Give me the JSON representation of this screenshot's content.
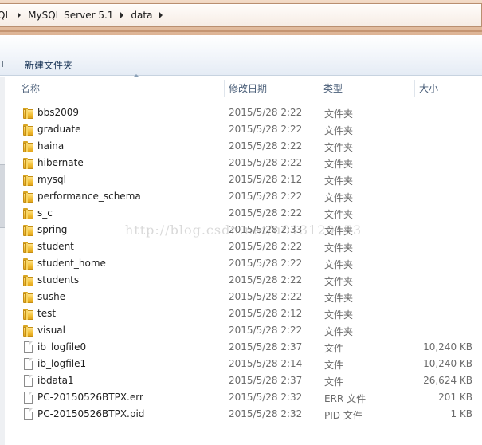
{
  "breadcrumb": {
    "items": [
      "QL",
      "MySQL Server 5.1",
      "data"
    ]
  },
  "toolbar": {
    "new_folder_label": "新建文件夹"
  },
  "columns": {
    "name": "名称",
    "date": "修改日期",
    "type": "类型",
    "size": "大小"
  },
  "rows": [
    {
      "name": "bbs2009",
      "date": "2015/5/28 2:22",
      "type": "文件夹",
      "size": "",
      "icon": "folder-icon"
    },
    {
      "name": "graduate",
      "date": "2015/5/28 2:22",
      "type": "文件夹",
      "size": "",
      "icon": "folder-icon"
    },
    {
      "name": "haina",
      "date": "2015/5/28 2:22",
      "type": "文件夹",
      "size": "",
      "icon": "folder-icon"
    },
    {
      "name": "hibernate",
      "date": "2015/5/28 2:22",
      "type": "文件夹",
      "size": "",
      "icon": "folder-icon"
    },
    {
      "name": "mysql",
      "date": "2015/5/28 2:12",
      "type": "文件夹",
      "size": "",
      "icon": "folder-icon"
    },
    {
      "name": "performance_schema",
      "date": "2015/5/28 2:22",
      "type": "文件夹",
      "size": "",
      "icon": "folder-icon"
    },
    {
      "name": "s_c",
      "date": "2015/5/28 2:22",
      "type": "文件夹",
      "size": "",
      "icon": "folder-icon"
    },
    {
      "name": "spring",
      "date": "2015/5/28 2:33",
      "type": "文件夹",
      "size": "",
      "icon": "folder-icon"
    },
    {
      "name": "student",
      "date": "2015/5/28 2:22",
      "type": "文件夹",
      "size": "",
      "icon": "folder-icon"
    },
    {
      "name": "student_home",
      "date": "2015/5/28 2:22",
      "type": "文件夹",
      "size": "",
      "icon": "folder-icon"
    },
    {
      "name": "students",
      "date": "2015/5/28 2:22",
      "type": "文件夹",
      "size": "",
      "icon": "folder-icon"
    },
    {
      "name": "sushe",
      "date": "2015/5/28 2:22",
      "type": "文件夹",
      "size": "",
      "icon": "folder-icon"
    },
    {
      "name": "test",
      "date": "2015/5/28 2:12",
      "type": "文件夹",
      "size": "",
      "icon": "folder-icon"
    },
    {
      "name": "visual",
      "date": "2015/5/28 2:22",
      "type": "文件夹",
      "size": "",
      "icon": "folder-icon"
    },
    {
      "name": "ib_logfile0",
      "date": "2015/5/28 2:37",
      "type": "文件",
      "size": "10,240 KB",
      "icon": "file-icon"
    },
    {
      "name": "ib_logfile1",
      "date": "2015/5/28 2:14",
      "type": "文件",
      "size": "10,240 KB",
      "icon": "file-icon"
    },
    {
      "name": "ibdata1",
      "date": "2015/5/28 2:37",
      "type": "文件",
      "size": "26,624 KB",
      "icon": "file-icon"
    },
    {
      "name": "PC-20150526BTPX.err",
      "date": "2015/5/28 2:32",
      "type": "ERR 文件",
      "size": "201 KB",
      "icon": "file-icon"
    },
    {
      "name": "PC-20150526BTPX.pid",
      "date": "2015/5/28 2:32",
      "type": "PID 文件",
      "size": "1 KB",
      "icon": "file-icon"
    }
  ],
  "watermark": "http://blog.csdn.net/u013120173",
  "colors": {
    "accent_band": "#e6c3a6",
    "header_text": "#4c607a",
    "folder_yellow": "#f3c13a",
    "secondary_text": "#6b6b6b"
  }
}
